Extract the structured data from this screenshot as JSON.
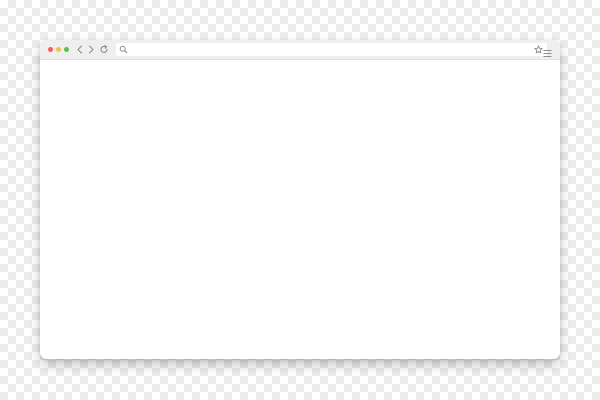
{
  "window": {
    "controls": {
      "close_color": "#f0615a",
      "minimize_color": "#f6be4f",
      "maximize_color": "#58c24d"
    },
    "icon_color": "#8c8c8c",
    "toolbar": {
      "back_icon": "chevron-left-icon",
      "forward_icon": "chevron-right-icon",
      "reload_icon": "reload-icon",
      "menu_icon": "hamburger-menu-icon"
    },
    "address_bar": {
      "value": "",
      "search_icon": "search-icon",
      "bookmark_icon": "star-icon"
    },
    "content": {
      "background": "#ffffff"
    }
  }
}
